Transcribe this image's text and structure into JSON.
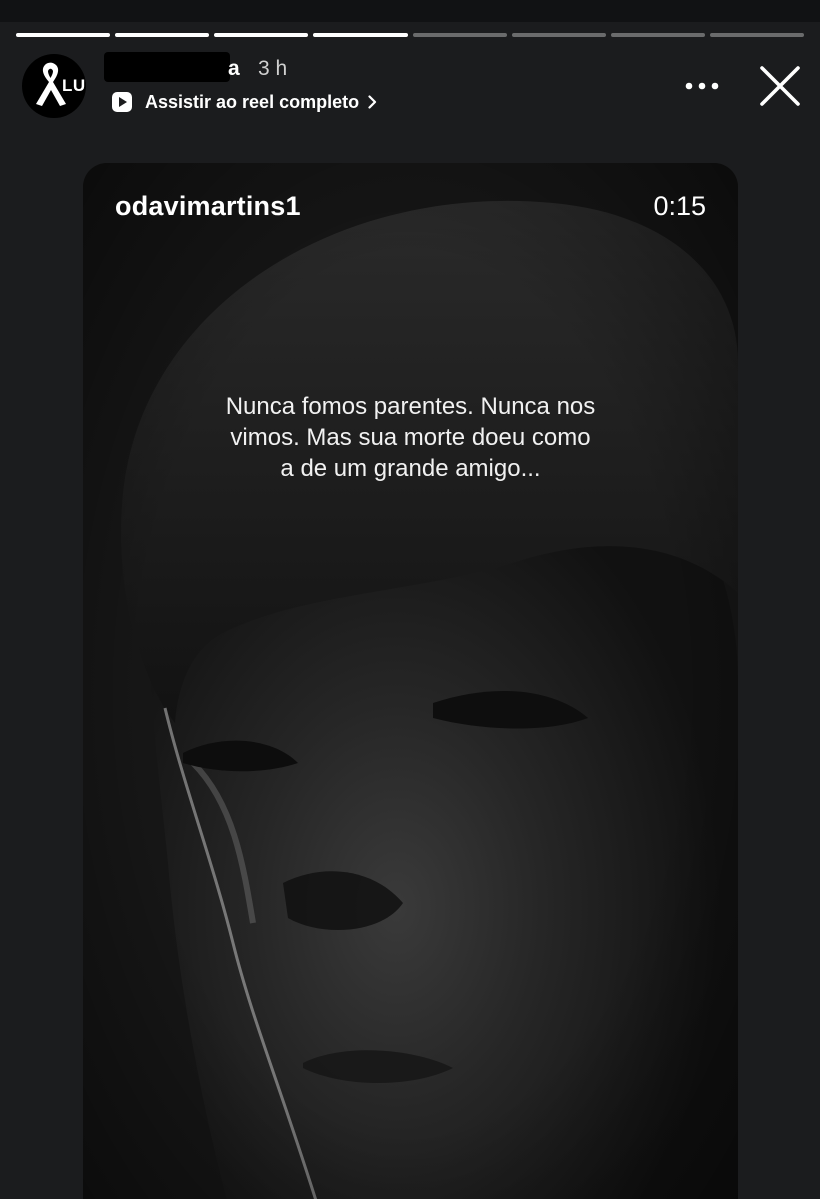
{
  "story": {
    "segments_total": 8,
    "segments_completed": 4,
    "current_segment_progress": 0
  },
  "header": {
    "avatar_text": "LUTO",
    "username_visible_tail": "a",
    "time_ago": "3 h",
    "reel_link_label": "Assistir ao reel completo",
    "more_icon": "more-horizontal-icon",
    "close_icon": "close-icon"
  },
  "reel_card": {
    "username": "odavimartins1",
    "duration": "0:15",
    "caption_lines": [
      "Nunca fomos parentes. Nunca nos",
      "vimos. Mas sua morte doeu como",
      "a de um grande amigo..."
    ]
  },
  "colors": {
    "background": "#1b1c1e",
    "progress_active": "#ffffff",
    "progress_inactive": "rgba(255,255,255,0.35)"
  }
}
